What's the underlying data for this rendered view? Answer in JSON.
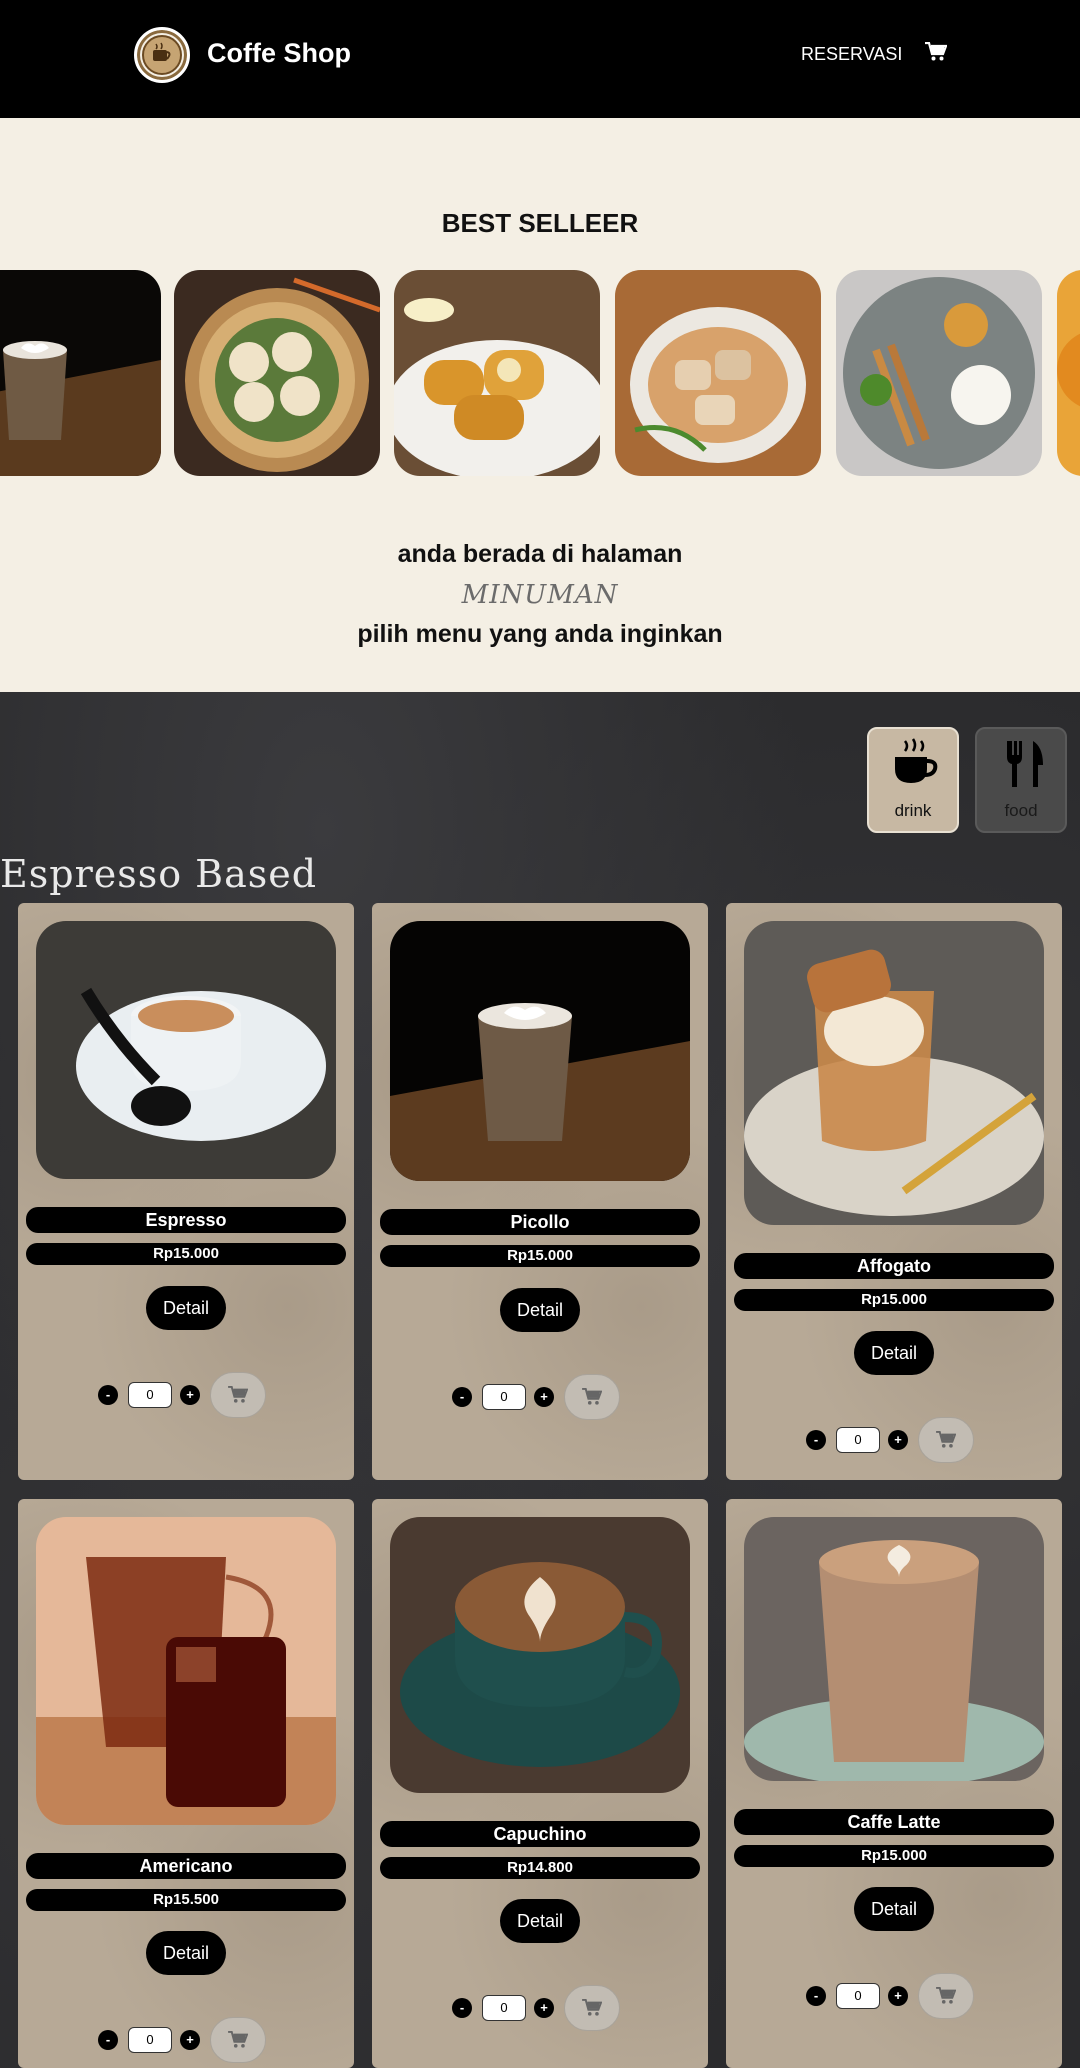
{
  "header": {
    "brand": "Coffe Shop",
    "nav_reservasi": "RESERVASI",
    "cart_icon": "cart-icon",
    "logo_icon": "coffee-logo-icon"
  },
  "best_seller": {
    "title": "BEST SELLEER",
    "items": [
      "piccolo-latte-image",
      "dimsum-image",
      "fried-roll-image",
      "fried-siomay-image",
      "satay-rice-image",
      "orange-dessert-image"
    ]
  },
  "intro": {
    "line1": "anda berada di halaman",
    "line2": "MINUMAN",
    "line3": "pilih menu yang anda inginkan"
  },
  "categories": [
    {
      "label": "drink",
      "icon": "coffee-cup-icon",
      "active": true
    },
    {
      "label": "food",
      "icon": "fork-knife-icon",
      "active": false
    }
  ],
  "section_title": "Espresso Based",
  "products": [
    {
      "name": "Espresso",
      "price": "Rp15.000",
      "detail": "Detail",
      "qty": "0",
      "minus": "-",
      "plus": "+"
    },
    {
      "name": "Picollo",
      "price": "Rp15.000",
      "detail": "Detail",
      "qty": "0",
      "minus": "-",
      "plus": "+"
    },
    {
      "name": "Affogato",
      "price": "Rp15.000",
      "detail": "Detail",
      "qty": "0",
      "minus": "-",
      "plus": "+"
    },
    {
      "name": "Americano",
      "price": "Rp15.500",
      "detail": "Detail",
      "qty": "0",
      "minus": "-",
      "plus": "+"
    },
    {
      "name": "Capuchino",
      "price": "Rp14.800",
      "detail": "Detail",
      "qty": "0",
      "minus": "-",
      "plus": "+"
    },
    {
      "name": "Caffe Latte",
      "price": "Rp15.000",
      "detail": "Detail",
      "qty": "0",
      "minus": "-",
      "plus": "+"
    }
  ],
  "colors": {
    "header_bg": "#000000",
    "page_bg": "#f4efe4",
    "dark_section": "#2b2b2d",
    "card_bg": "#b7a996",
    "pill_bg": "#000000"
  }
}
